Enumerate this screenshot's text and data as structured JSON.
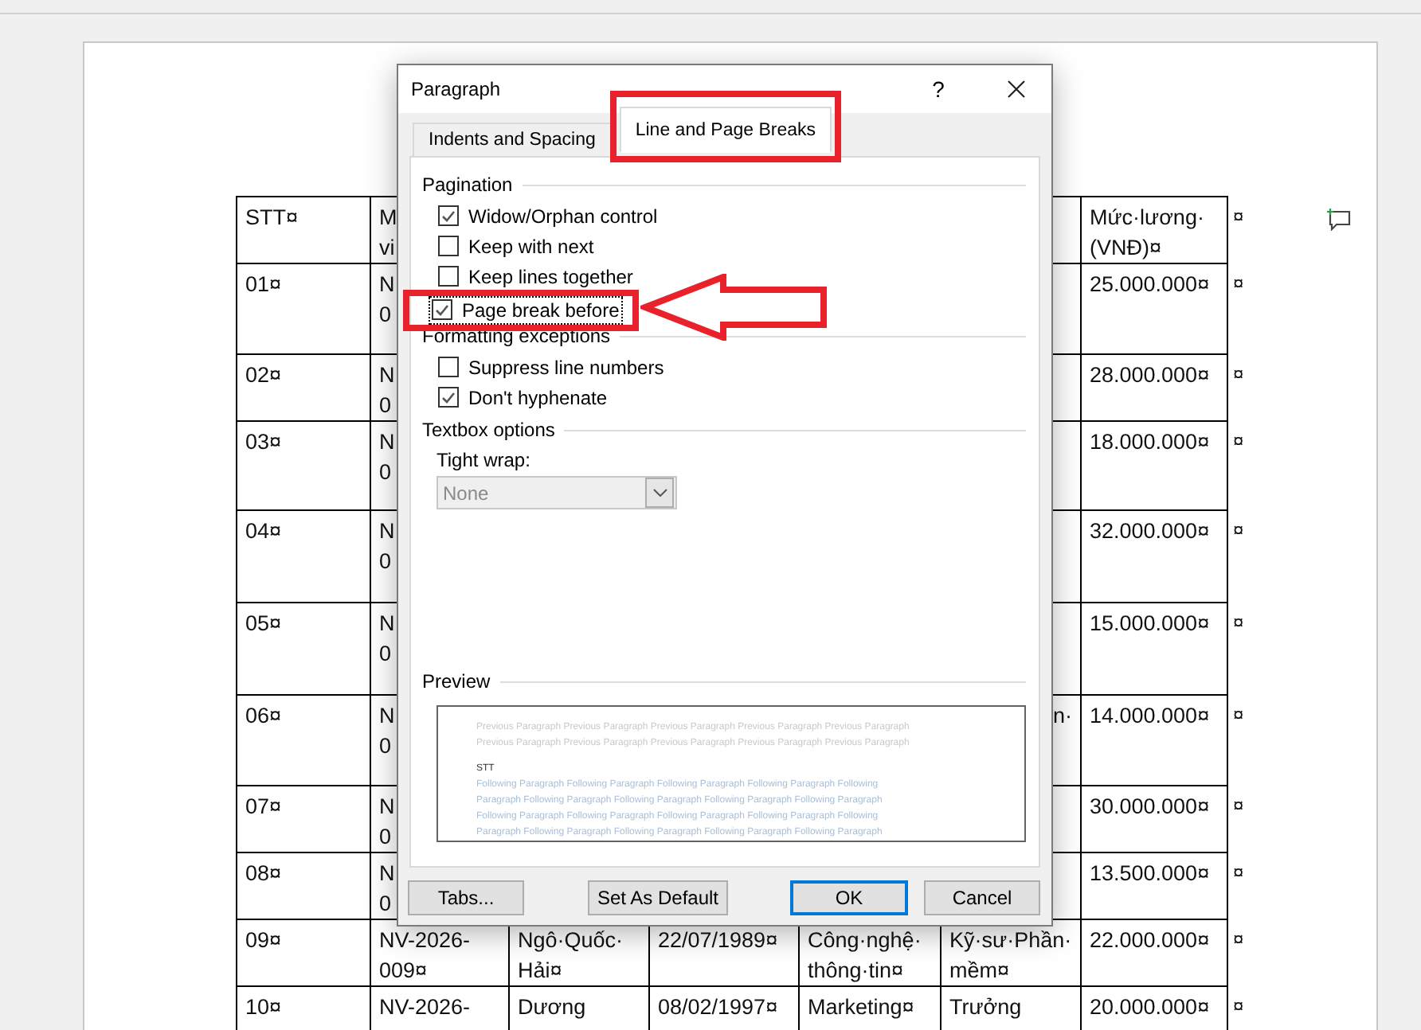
{
  "document": {
    "table": {
      "header": {
        "cells": [
          "STT¤",
          "M\nvi",
          null,
          null,
          null,
          null,
          "Mức·lương·(VNĐ)¤"
        ],
        "end": "¤"
      },
      "rows": [
        {
          "cells": [
            "01¤",
            "N\n0",
            null,
            null,
            null,
            null,
            "25.000.000¤"
          ],
          "end": "¤"
        },
        {
          "cells": [
            "02¤",
            "N\n0",
            null,
            null,
            null,
            null,
            "28.000.000¤"
          ],
          "end": "¤"
        },
        {
          "cells": [
            "03¤",
            "N\n0",
            null,
            null,
            null,
            null,
            "18.000.000¤"
          ],
          "end": "¤"
        },
        {
          "cells": [
            "04¤",
            "N\n0",
            null,
            null,
            null,
            null,
            "32.000.000¤"
          ],
          "end": "¤"
        },
        {
          "cells": [
            "05¤",
            "N\n0",
            null,
            null,
            null,
            null,
            "15.000.000¤"
          ],
          "end": "¤"
        },
        {
          "cells": [
            "06¤",
            "N\n0",
            null,
            null,
            null,
            "n·",
            "14.000.000¤"
          ],
          "end": "¤"
        },
        {
          "cells": [
            "07¤",
            "N\n0",
            null,
            null,
            null,
            null,
            "30.000.000¤"
          ],
          "end": "¤"
        },
        {
          "cells": [
            "08¤",
            "N\n0",
            null,
            null,
            null,
            null,
            "13.500.000¤"
          ],
          "end": "¤"
        },
        {
          "cells": [
            "09¤",
            "NV-2026-009¤",
            "Ngô·Quốc·Hải¤",
            "22/07/1989¤",
            "Công·nghệ·thông·tin¤",
            "Kỹ·sư·Phần·mềm¤",
            "22.000.000¤"
          ],
          "end": "¤"
        },
        {
          "cells": [
            "10¤",
            "NV-2026-",
            "Dương",
            "08/02/1997¤",
            "Marketing¤",
            "Trưởng",
            "20.000.000¤"
          ],
          "end": "¤"
        }
      ]
    }
  },
  "dialog": {
    "title": "Paragraph",
    "help": "?",
    "tabs": [
      {
        "label": "Indents and Spacing",
        "selected": false,
        "highlighted": false
      },
      {
        "label": "Line and Page Breaks",
        "selected": true,
        "highlighted": true
      }
    ],
    "sections": [
      {
        "title": "Pagination",
        "options": [
          {
            "label": "Widow/Orphan control",
            "checked": true,
            "focused": false,
            "highlighted": false
          },
          {
            "label": "Keep with next",
            "checked": false,
            "focused": false,
            "highlighted": false
          },
          {
            "label": "Keep lines together",
            "checked": false,
            "focused": false,
            "highlighted": false
          },
          {
            "label": "Page break before",
            "checked": true,
            "focused": true,
            "highlighted": true
          }
        ]
      },
      {
        "title": "Formatting exceptions",
        "options": [
          {
            "label": "Suppress line numbers",
            "checked": false,
            "focused": false,
            "highlighted": false
          },
          {
            "label": "Don't hyphenate",
            "checked": true,
            "focused": false,
            "highlighted": false
          }
        ]
      }
    ],
    "textbox_options": {
      "title": "Textbox options",
      "label": "Tight wrap:",
      "value": "None",
      "disabled": true
    },
    "preview": {
      "title": "Preview",
      "previous_lines": [
        "Previous Paragraph Previous Paragraph Previous Paragraph Previous Paragraph Previous Paragraph",
        "Previous Paragraph Previous Paragraph Previous Paragraph Previous Paragraph Previous Paragraph"
      ],
      "current": "STT",
      "following_lines": [
        "Following Paragraph Following Paragraph Following Paragraph Following Paragraph Following",
        "Paragraph Following Paragraph Following Paragraph Following Paragraph Following Paragraph",
        "Following Paragraph Following Paragraph Following Paragraph Following Paragraph Following",
        "Paragraph Following Paragraph Following Paragraph Following Paragraph Following Paragraph"
      ]
    },
    "buttons": [
      {
        "label": "Tabs...",
        "default": false
      },
      {
        "label": "Set As Default",
        "default": false
      },
      {
        "label": "OK",
        "default": true
      },
      {
        "label": "Cancel",
        "default": false
      }
    ]
  }
}
